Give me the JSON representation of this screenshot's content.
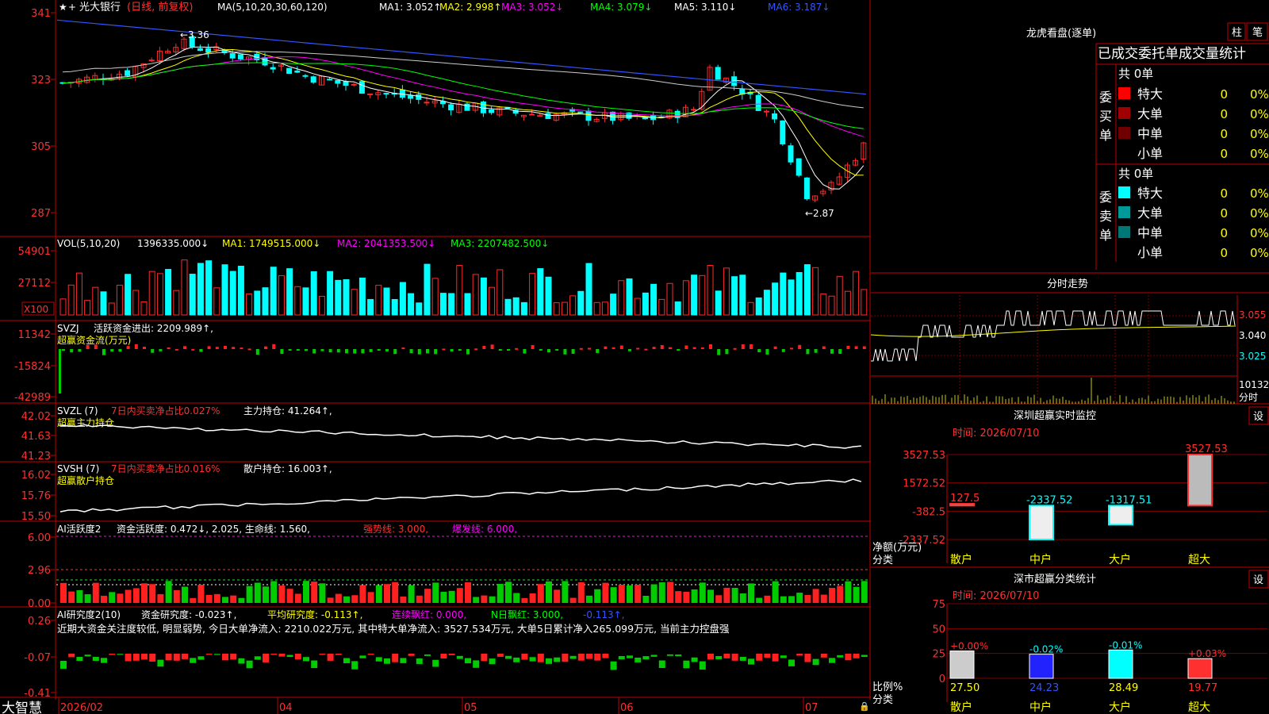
{
  "header": {
    "stock_name": "光大银行",
    "period_mode": "(日线, 前复权)",
    "ma_label": "MA(5,10,20,30,60,120)",
    "ma_values": [
      {
        "text": "MA1: 3.052↑",
        "color": "#ffffff"
      },
      {
        "text": "MA2: 2.998↑",
        "color": "#ffff00"
      },
      {
        "text": "MA3: 3.052↓",
        "color": "#ff00ff"
      },
      {
        "text": "MA4: 3.079↓",
        "color": "#00ff00"
      },
      {
        "text": "MA5: 3.110↓",
        "color": "#ffffff"
      },
      {
        "text": "MA6: 3.187↓",
        "color": "#3355ff"
      }
    ]
  },
  "price_panel": {
    "y_ticks": [
      "341",
      "323",
      "305",
      "287"
    ],
    "high_label": "←3.36",
    "low_label": "←2.87",
    "ylim": [
      2.82,
      3.42
    ]
  },
  "volume_panel": {
    "title": "VOL(5,10,20)",
    "vol": "1396335.000↓",
    "ma_values": [
      {
        "text": "MA1: 1749515.000↓",
        "color": "#ffff00"
      },
      {
        "text": "MA2: 2041353.500↓",
        "color": "#ff00ff"
      },
      {
        "text": "MA3: 2207482.500↓",
        "color": "#00ff00"
      }
    ],
    "y_ticks": [
      "54901",
      "27112"
    ],
    "unit": "X100"
  },
  "svzj_panel": {
    "title": "SVZJ",
    "value_text": "活跃资金进出: 2209.989↑,",
    "subtitle": "超赢资金流(万元)",
    "y_ticks": [
      "11342",
      "-15824",
      "-42989"
    ]
  },
  "svzl_panel": {
    "title": "SVZL (7)",
    "ratio_text": "7日内买卖净占比0.027%",
    "value_text": "主力持仓: 41.264↑,",
    "subtitle": "超赢主力持仓",
    "y_ticks": [
      "42.02",
      "41.63",
      "41.23"
    ]
  },
  "svsh_panel": {
    "title": "SVSH (7)",
    "ratio_text": "7日内买卖净占比0.016%",
    "value_text": "散户持仓: 16.003↑,",
    "subtitle": "超赢散户持仓",
    "y_ticks": [
      "16.02",
      "15.76",
      "15.50"
    ]
  },
  "ai_active_panel": {
    "title": "AI活跃度2",
    "value_text": "资金活跃度: 0.472↓, 2.025, 生命线: 1.560,",
    "strong_line": "强势线: 3.000,",
    "burst_line": "爆发线: 6.000,",
    "y_ticks": [
      "6.00",
      "2.96",
      "0.00"
    ]
  },
  "ai_research_panel": {
    "title": "AI研究度2(10)",
    "value_text": "资金研究度: -0.023↑,",
    "avg_text": "平均研究度: -0.113↑,",
    "red_text": "连续飘红: 0.000,",
    "n_red_text": "N日飘红: 3.000,",
    "tail_text": "-0.113↑,",
    "comment": "近期大资金关注度较低, 明显弱势, 今日大单净流入: 2210.022万元, 其中特大单净流入: 3527.534万元, 大单5日累计净入265.099万元, 当前主力控盘强",
    "y_ticks": [
      "0.26",
      "-0.07",
      "-0.41"
    ]
  },
  "x_axis": {
    "brand": "大智慧",
    "labels": [
      "2026/02",
      "04",
      "05",
      "06",
      "07"
    ]
  },
  "dragon_tiger": {
    "title": "龙虎看盘(逐单)",
    "tab_bar": "柱",
    "tab_line": "笔",
    "header": "已成交委托单成交量统计",
    "buy_side_label": "委买单",
    "sell_side_label": "委卖单",
    "buy_total": "共 0单",
    "sell_total": "共 0单",
    "buy_rows": [
      {
        "label": "特大",
        "count": "0",
        "pct": "0%",
        "color": "#ff0000"
      },
      {
        "label": "大单",
        "count": "0",
        "pct": "0%",
        "color": "#a00000"
      },
      {
        "label": "中单",
        "count": "0",
        "pct": "0%",
        "color": "#700000"
      },
      {
        "label": "小单",
        "count": "0",
        "pct": "0%",
        "color": ""
      }
    ],
    "sell_rows": [
      {
        "label": "特大",
        "count": "0",
        "pct": "0%",
        "color": "#00ffff"
      },
      {
        "label": "大单",
        "count": "0",
        "pct": "0%",
        "color": "#009999"
      },
      {
        "label": "中单",
        "count": "0",
        "pct": "0%",
        "color": "#007777"
      },
      {
        "label": "小单",
        "count": "0",
        "pct": "0%",
        "color": ""
      }
    ]
  },
  "intraday": {
    "title": "分时走势",
    "right_ticks": [
      "3.055",
      "3.040",
      "3.025"
    ],
    "vol_tick": "10132",
    "vol_unit": "分时"
  },
  "sz_monitor": {
    "title": "深圳超赢实时监控",
    "settings_label": "设",
    "time_text": "时间: 2026/07/10",
    "y_ticks": [
      "3527.53",
      "1572.52",
      "-382.5",
      "-2337.52"
    ],
    "y_label": "净额(万元)",
    "x_label": "分类",
    "categories": [
      "散户",
      "中户",
      "大户",
      "超大"
    ],
    "values": [
      127.5,
      -2337.52,
      -1317.51,
      3527.53
    ],
    "value_labels": [
      "127.5",
      "-2337.52",
      "-1317.51",
      "3527.53"
    ]
  },
  "sz_classify": {
    "title": "深市超赢分类统计",
    "settings_label": "设",
    "time_text": "时间: 2026/07/10",
    "y_ticks": [
      "75",
      "50",
      "25",
      "0"
    ],
    "y_label": "比例%",
    "x_label": "分类",
    "categories": [
      "散户",
      "中户",
      "大户",
      "超大"
    ],
    "values": [
      27.5,
      24.23,
      28.49,
      19.77
    ],
    "value_labels": [
      "27.50",
      "24.23",
      "28.49",
      "19.77"
    ],
    "change_labels": [
      "+0.00%",
      "-0.02%",
      "-0.01%",
      "+0.03%"
    ]
  },
  "chart_data": {
    "type": "bar",
    "title": "深圳超赢实时监控",
    "categories": [
      "散户",
      "中户",
      "大户",
      "超大"
    ],
    "series": [
      {
        "name": "净额(万元)",
        "values": [
          127.5,
          -2337.52,
          -1317.51,
          3527.53
        ]
      }
    ],
    "ylim": [
      -2337.52,
      3527.53
    ]
  },
  "colors": {
    "up": "#ff2a2a",
    "down": "#00ffff",
    "grid": "#c00000",
    "axis_text": "#ff3030"
  }
}
